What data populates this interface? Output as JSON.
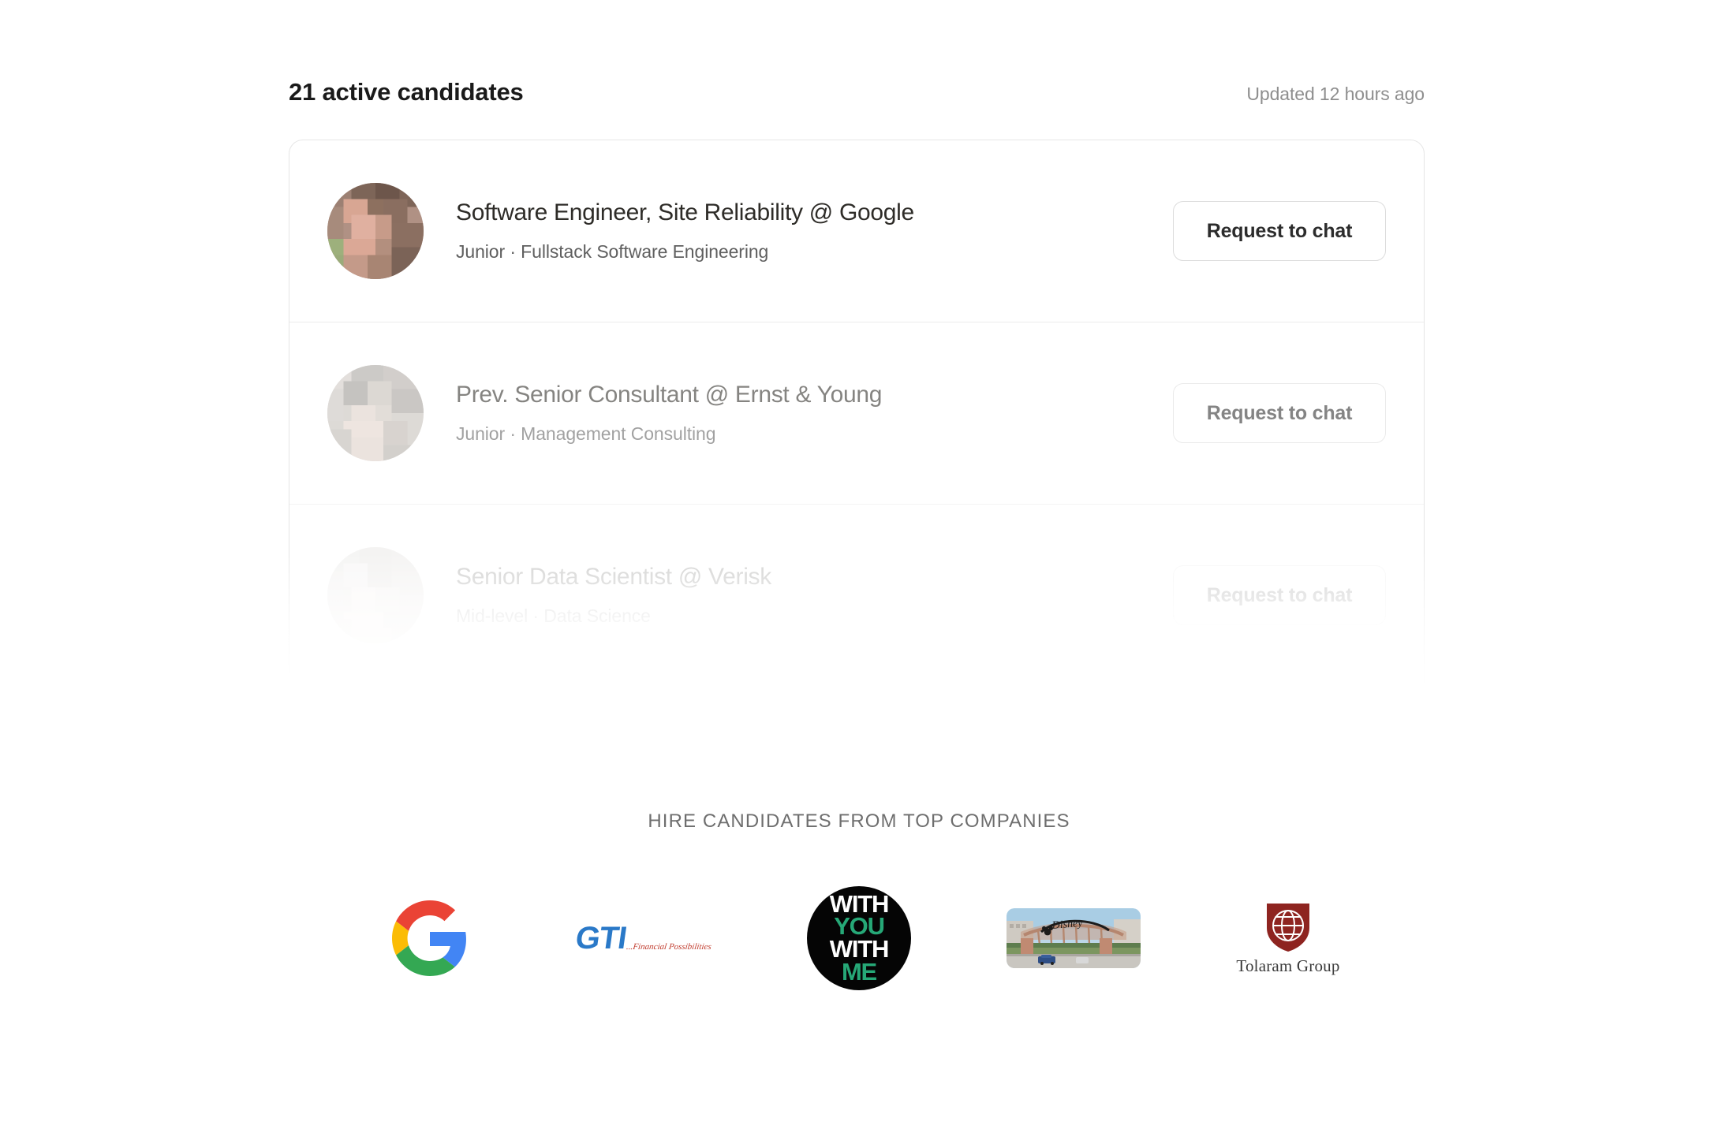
{
  "header": {
    "title": "21 active candidates",
    "updated": "Updated 12 hours ago"
  },
  "candidates": [
    {
      "title": "Software Engineer, Site Reliability @ Google",
      "subtitle": "Junior · Fullstack Software Engineering",
      "action_label": "Request to chat",
      "avatar_alt": "blurred-candidate-photo"
    },
    {
      "title": "Prev. Senior Consultant @ Ernst & Young",
      "subtitle": "Junior · Management Consulting",
      "action_label": "Request to chat",
      "avatar_alt": "blurred-candidate-photo"
    },
    {
      "title": "Senior Data Scientist @ Verisk",
      "subtitle": "Mid-level · Data Science",
      "action_label": "Request to chat",
      "avatar_alt": "blurred-candidate-photo"
    }
  ],
  "logos_section": {
    "heading": "HIRE CANDIDATES FROM TOP COMPANIES",
    "logos": [
      {
        "name": "google-logo",
        "label": "Google"
      },
      {
        "name": "gti-logo",
        "label": "GTI",
        "tagline": "...Financial Possibilities"
      },
      {
        "name": "with-you-with-me-logo",
        "line1": "WITH",
        "line2": "YOU",
        "line3": "WITH",
        "line4": "ME"
      },
      {
        "name": "walt-disney-studios-logo",
        "label": "Walt Disney Studios"
      },
      {
        "name": "tolaram-group-logo",
        "label": "Tolaram Group"
      }
    ]
  },
  "colors": {
    "text_primary": "#1a1a1a",
    "text_muted": "#8e8e8e",
    "card_border": "#e6e6e6",
    "google_blue": "#4285F4",
    "google_red": "#EA4335",
    "google_yellow": "#FBBC05",
    "google_green": "#34A853",
    "gti_blue": "#2a79c8",
    "gti_red": "#c0392b",
    "wywm_green": "#26a877",
    "tolaram_red": "#8e2420"
  }
}
